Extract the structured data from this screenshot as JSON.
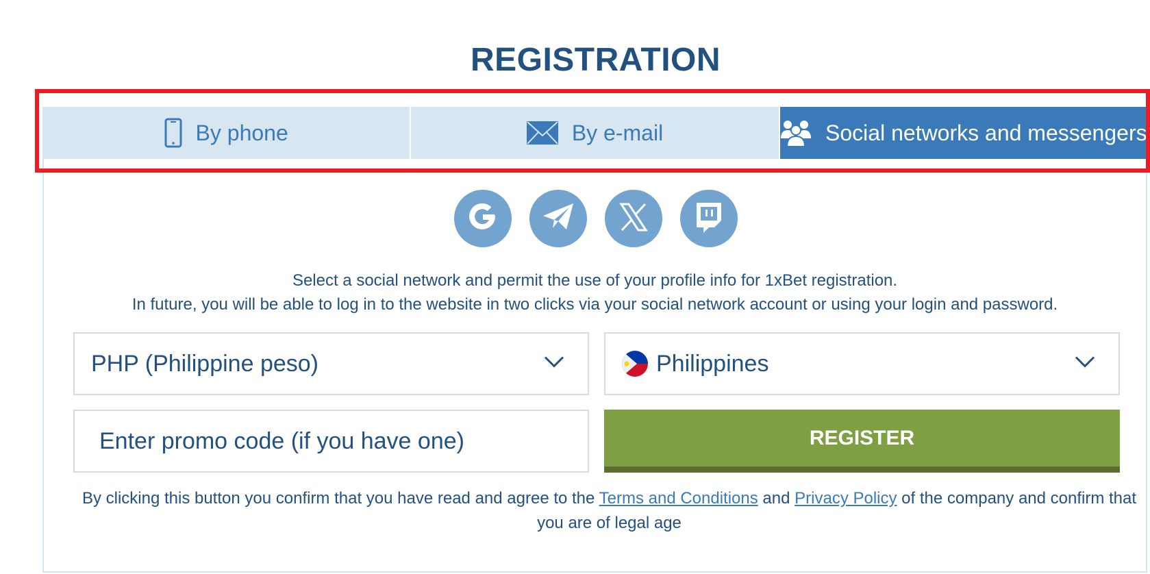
{
  "page": {
    "title": "REGISTRATION"
  },
  "tabs": [
    {
      "label": "By phone",
      "icon": "phone-icon",
      "active": false
    },
    {
      "label": "By e-mail",
      "icon": "envelope-icon",
      "active": false
    },
    {
      "label": "Social networks and messengers",
      "icon": "users-icon",
      "active": true
    }
  ],
  "socials": [
    {
      "name": "Google",
      "icon": "google-icon"
    },
    {
      "name": "Telegram",
      "icon": "telegram-icon"
    },
    {
      "name": "X",
      "icon": "x-icon"
    },
    {
      "name": "Twitch",
      "icon": "twitch-icon"
    }
  ],
  "info": {
    "line1": "Select a social network and permit the use of your profile info for 1xBet registration.",
    "line2": "In future, you will be able to log in to the website in two clicks via your social network account or using your login and password."
  },
  "form": {
    "currency": "PHP (Philippine peso)",
    "country": "Philippines",
    "promo_placeholder": "Enter promo code (if you have one)",
    "promo_value": "",
    "register_label": "REGISTER"
  },
  "terms": {
    "prefix": "By clicking this button you confirm that you have read and agree to the ",
    "terms_link": "Terms and Conditions",
    "and": " and ",
    "privacy_link": "Privacy Policy",
    "suffix": " of the company and confirm that you are of legal age"
  },
  "colors": {
    "heading": "#23517f",
    "tab_inactive_bg": "#d8e6f2",
    "tab_active_bg": "#3a7ab9",
    "social_icon_bg": "#73a3cf",
    "register_bg": "#7ea043",
    "highlight": "#ec1c24"
  }
}
